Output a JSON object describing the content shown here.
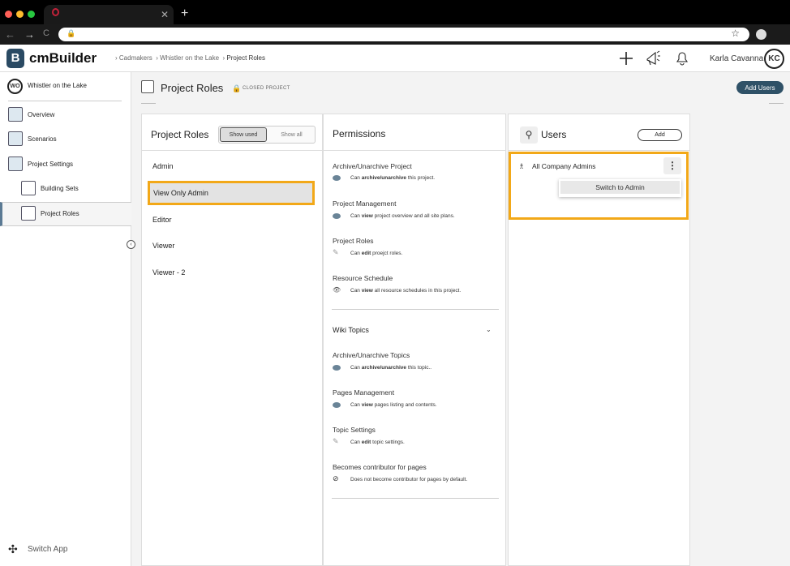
{
  "browser": {
    "new_tab": "+",
    "back": "←",
    "forward": "→",
    "reload": "C",
    "tab_close": "✕",
    "star": "☆"
  },
  "header": {
    "brand": "cmBuilder",
    "logo_letter": "B",
    "breadcrumbs": [
      "Cadmakers",
      "Whistler on the Lake",
      "Project Roles"
    ],
    "user_name": "Karla Cavanna",
    "user_initials": "KC"
  },
  "sidebar": {
    "project_initials": "WO",
    "project_name": "Whistler on the Lake",
    "items": [
      {
        "label": "Overview",
        "icon": "overview-icon"
      },
      {
        "label": "Scenarios",
        "icon": "scenarios-icon"
      },
      {
        "label": "Project Settings",
        "icon": "settings-icon"
      },
      {
        "label": "Building Sets",
        "icon": "building-icon"
      },
      {
        "label": "Project Roles",
        "icon": "roles-icon",
        "active": true
      }
    ],
    "switch_app": "Switch App"
  },
  "page": {
    "title": "Project Roles",
    "status": "CLOSED PROJECT",
    "add_users": "Add Users"
  },
  "roles_panel": {
    "title": "Project Roles",
    "show_used": "Show used",
    "show_all": "Show all",
    "roles": [
      "Admin",
      "View Only Admin",
      "Editor",
      "Viewer",
      "Viewer - 2"
    ],
    "selected": "View Only Admin"
  },
  "permissions_panel": {
    "title": "Permissions",
    "groups": [
      {
        "title": "Archive/Unarchive Project",
        "pre": "Can ",
        "bold": "archive/unarchive",
        "post": " this project."
      },
      {
        "title": "Project Management",
        "pre": "Can ",
        "bold": "view",
        "post": " project overview and all site plans."
      },
      {
        "title": "Project Roles",
        "pre": "Can ",
        "bold": "edit",
        "post": " proejct roles."
      },
      {
        "title": "Resource Schedule",
        "pre": "Can ",
        "bold": "view",
        "post": " all resource schedules in this project."
      }
    ],
    "wiki_title": "Wiki Topics",
    "wiki_groups": [
      {
        "title": "Archive/Unarchive Topics",
        "pre": "Can ",
        "bold": "archive/unarchive",
        "post": " this topic.."
      },
      {
        "title": "Pages Management",
        "pre": "Can ",
        "bold": "view",
        "post": " pages listing and contents."
      },
      {
        "title": "Topic Settings",
        "pre": "Can ",
        "bold": "edit",
        "post": " topic settings."
      },
      {
        "title": "Becomes contributor for pages",
        "pre": "Does not become contributor for pages by default.",
        "bold": "",
        "post": ""
      }
    ]
  },
  "users_panel": {
    "title": "Users",
    "add": "Add",
    "users": [
      {
        "name": "All Company Admins"
      }
    ],
    "menu_item": "Switch to Admin"
  },
  "colors": {
    "highlight": "#f2a818",
    "primary": "#2f5167"
  }
}
